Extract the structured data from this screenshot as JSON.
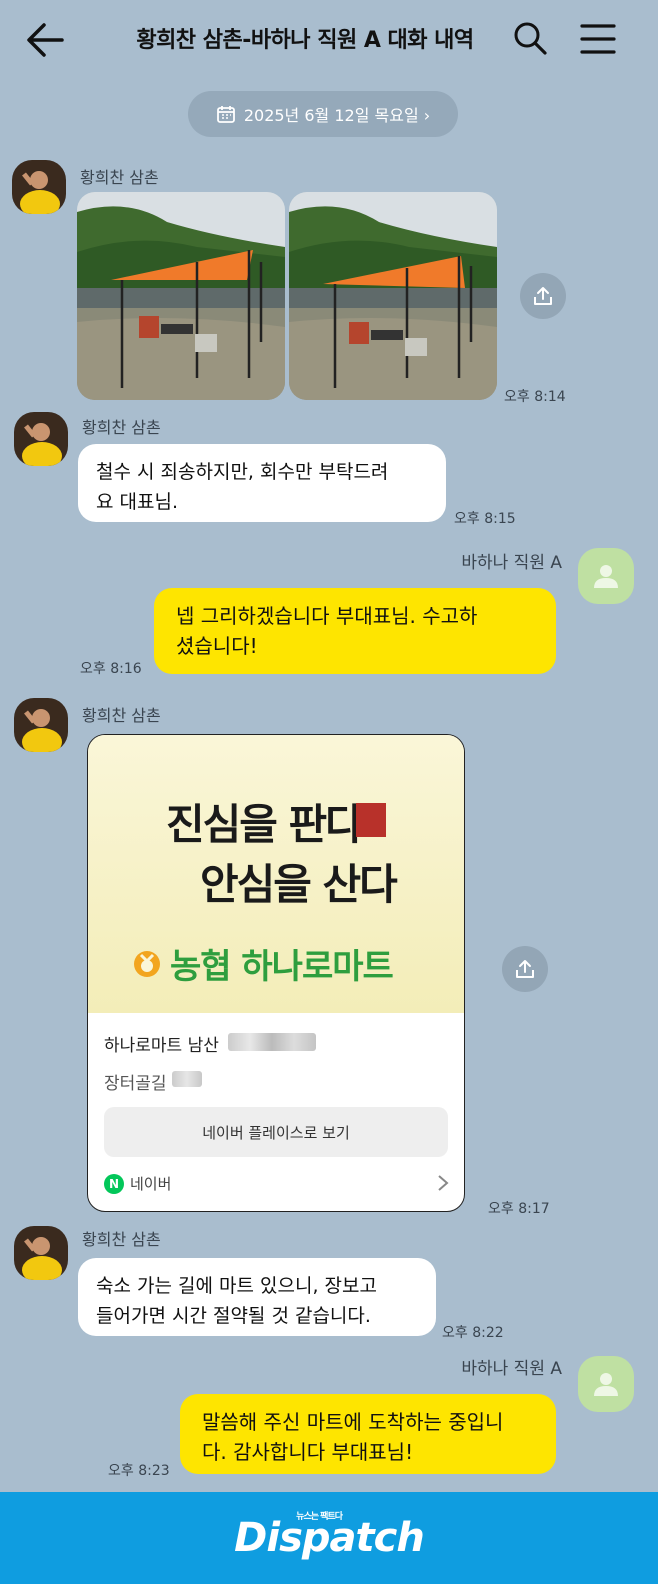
{
  "header": {
    "title": "황희찬 삼촌-바하나 직원 A 대화 내역"
  },
  "date_chip": {
    "label": "2025년 6월 12일 목요일 ›"
  },
  "messages": [
    {
      "sender": "황희찬 삼촌",
      "type": "photos",
      "time": "오후 8:14"
    },
    {
      "sender": "황희찬 삼촌",
      "type": "text",
      "text_line1": "철수 시 죄송하지만, 회수만 부탁드려",
      "text_line2": "요 대표님.",
      "time": "오후 8:15"
    },
    {
      "sender": "바하나 직원 A",
      "type": "text",
      "text_line1": "넵 그리하겠습니다 부대표님. 수고하",
      "text_line2": "셨습니다!",
      "time": "오후 8:16"
    },
    {
      "sender": "황희찬 삼촌",
      "type": "place_card",
      "time": "오후 8:17"
    },
    {
      "sender": "황희찬 삼촌",
      "type": "text",
      "text_line1": "숙소 가는 길에 마트 있으니, 장보고",
      "text_line2": "들어가면 시간 절약될 것 같습니다.",
      "time": "오후 8:22"
    },
    {
      "sender": "바하나 직원 A",
      "type": "text",
      "text_line1": "말씀해 주신 마트에 도착하는 중입니",
      "text_line2": "다. 감사합니다 부대표님!",
      "time": "오후 8:23"
    }
  ],
  "place_card": {
    "slogan_line1": "진심을 판다",
    "slogan_line2": "안심을 산다",
    "brand": "농협 하나로마트",
    "name": "하나로마트 남산",
    "address": "장터골길",
    "naver_button": "네이버 플레이스로 보기",
    "source": "네이버",
    "source_badge": "N"
  },
  "banner": {
    "logo": "Dispatch",
    "tagline": "뉴스는 팩트다"
  },
  "icons": [
    "back-arrow-icon",
    "search-icon",
    "menu-icon",
    "calendar-icon",
    "share-icon",
    "default-profile-icon",
    "chevron-right-icon"
  ],
  "colors": {
    "background": "#a9bdce",
    "outgoing_bubble": "#fee500",
    "incoming_bubble": "#ffffff",
    "banner": "#0f9de0"
  }
}
